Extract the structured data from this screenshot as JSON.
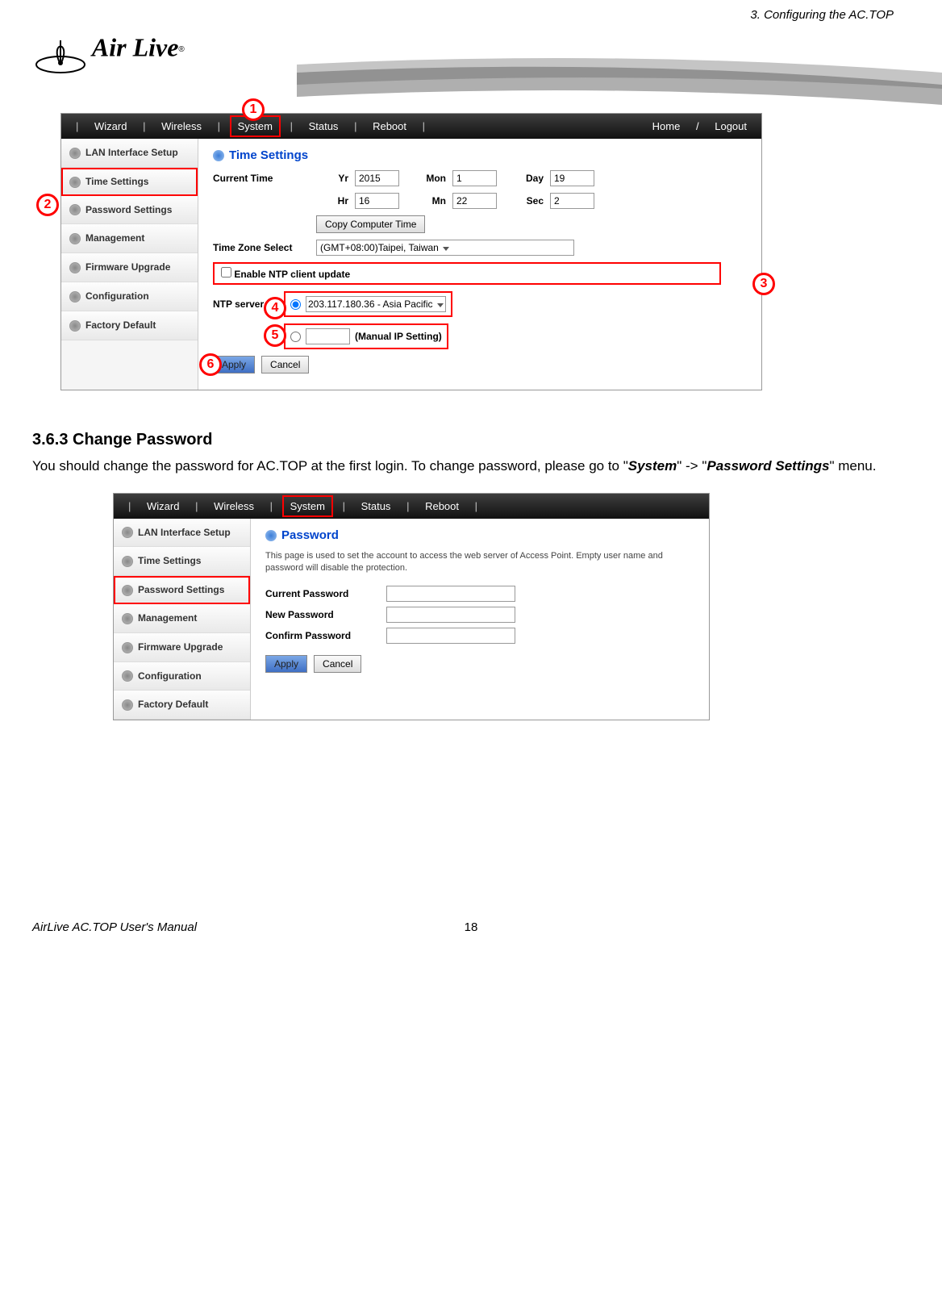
{
  "header": {
    "chapter": "3. Configuring the AC.TOP"
  },
  "logo": {
    "brand": "Air Live",
    "reg": "®"
  },
  "shot1": {
    "nav": {
      "wizard": "Wizard",
      "wireless": "Wireless",
      "system": "System",
      "status": "Status",
      "reboot": "Reboot",
      "home": "Home",
      "logout": "Logout",
      "sep": "|",
      "slash": "/"
    },
    "side": {
      "lan": "LAN Interface Setup",
      "time": "Time Settings",
      "pwd": "Password Settings",
      "mgmt": "Management",
      "fw": "Firmware Upgrade",
      "cfg": "Configuration",
      "fd": "Factory Default"
    },
    "title": "Time Settings",
    "labels": {
      "current": "Current Time",
      "yr": "Yr",
      "mon": "Mon",
      "day": "Day",
      "hr": "Hr",
      "mn": "Mn",
      "sec": "Sec",
      "tzselect": "Time Zone Select",
      "enablentp": "Enable NTP client update",
      "ntpserver": "NTP server",
      "manual": "(Manual IP Setting)"
    },
    "vals": {
      "yr": "2015",
      "mon": "1",
      "day": "19",
      "hr": "16",
      "mn": "22",
      "sec": "2",
      "tz": "(GMT+08:00)Taipei, Taiwan",
      "ntp": "203.117.180.36 - Asia Pacific"
    },
    "btns": {
      "copy": "Copy Computer Time",
      "apply": "Apply",
      "cancel": "Cancel"
    }
  },
  "callouts": {
    "c1": "1",
    "c2": "2",
    "c3": "3",
    "c4": "4",
    "c5": "5",
    "c6": "6"
  },
  "section": {
    "heading": "3.6.3 Change Password",
    "text_a": "You should change the password for AC.TOP at the first login.   To change password, please go to \"",
    "text_b": "System",
    "text_c": "\" -> \"",
    "text_d": "Password Settings",
    "text_e": "\" menu."
  },
  "shot2": {
    "title": "Password",
    "desc": "This page is used to set the account to access the web server of Access Point. Empty user name and password will disable the protection.",
    "labels": {
      "cur": "Current Password",
      "new": "New Password",
      "conf": "Confirm Password"
    },
    "btns": {
      "apply": "Apply",
      "cancel": "Cancel"
    }
  },
  "footer": {
    "manual": "AirLive AC.TOP User's Manual",
    "page": "18"
  }
}
